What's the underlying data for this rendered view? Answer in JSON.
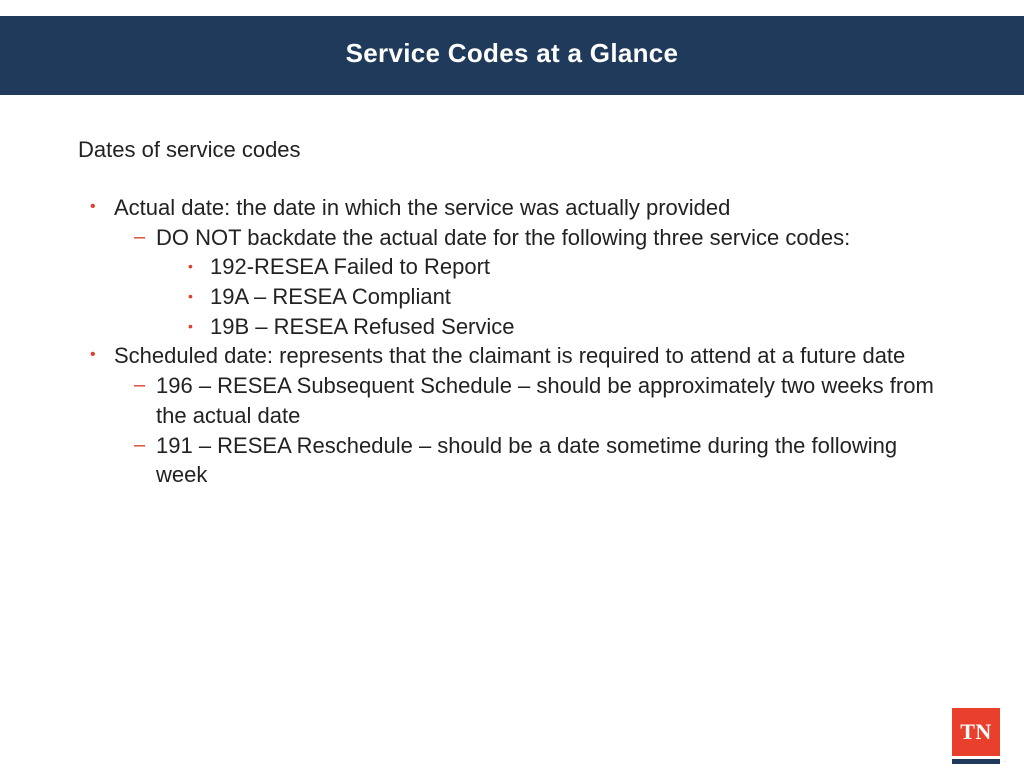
{
  "header": {
    "title": "Service Codes at a Glance"
  },
  "intro": "Dates of service codes",
  "items": [
    {
      "text": "Actual date: the date in which the service was actually provided",
      "sub": [
        {
          "text": "DO NOT backdate the actual date for the following three service codes:",
          "sub": [
            {
              "text": "192-RESEA Failed to Report"
            },
            {
              "text": "19A – RESEA Compliant"
            },
            {
              "text": "19B – RESEA Refused Service"
            }
          ]
        }
      ]
    },
    {
      "text": "Scheduled date: represents that the claimant is required to attend at a future date",
      "sub": [
        {
          "text": "196 – RESEA Subsequent Schedule – should be approximately two weeks from the actual date"
        },
        {
          "text": "191 – RESEA Reschedule – should be a date sometime during the following week"
        }
      ]
    }
  ],
  "logo": {
    "text": "TN"
  }
}
